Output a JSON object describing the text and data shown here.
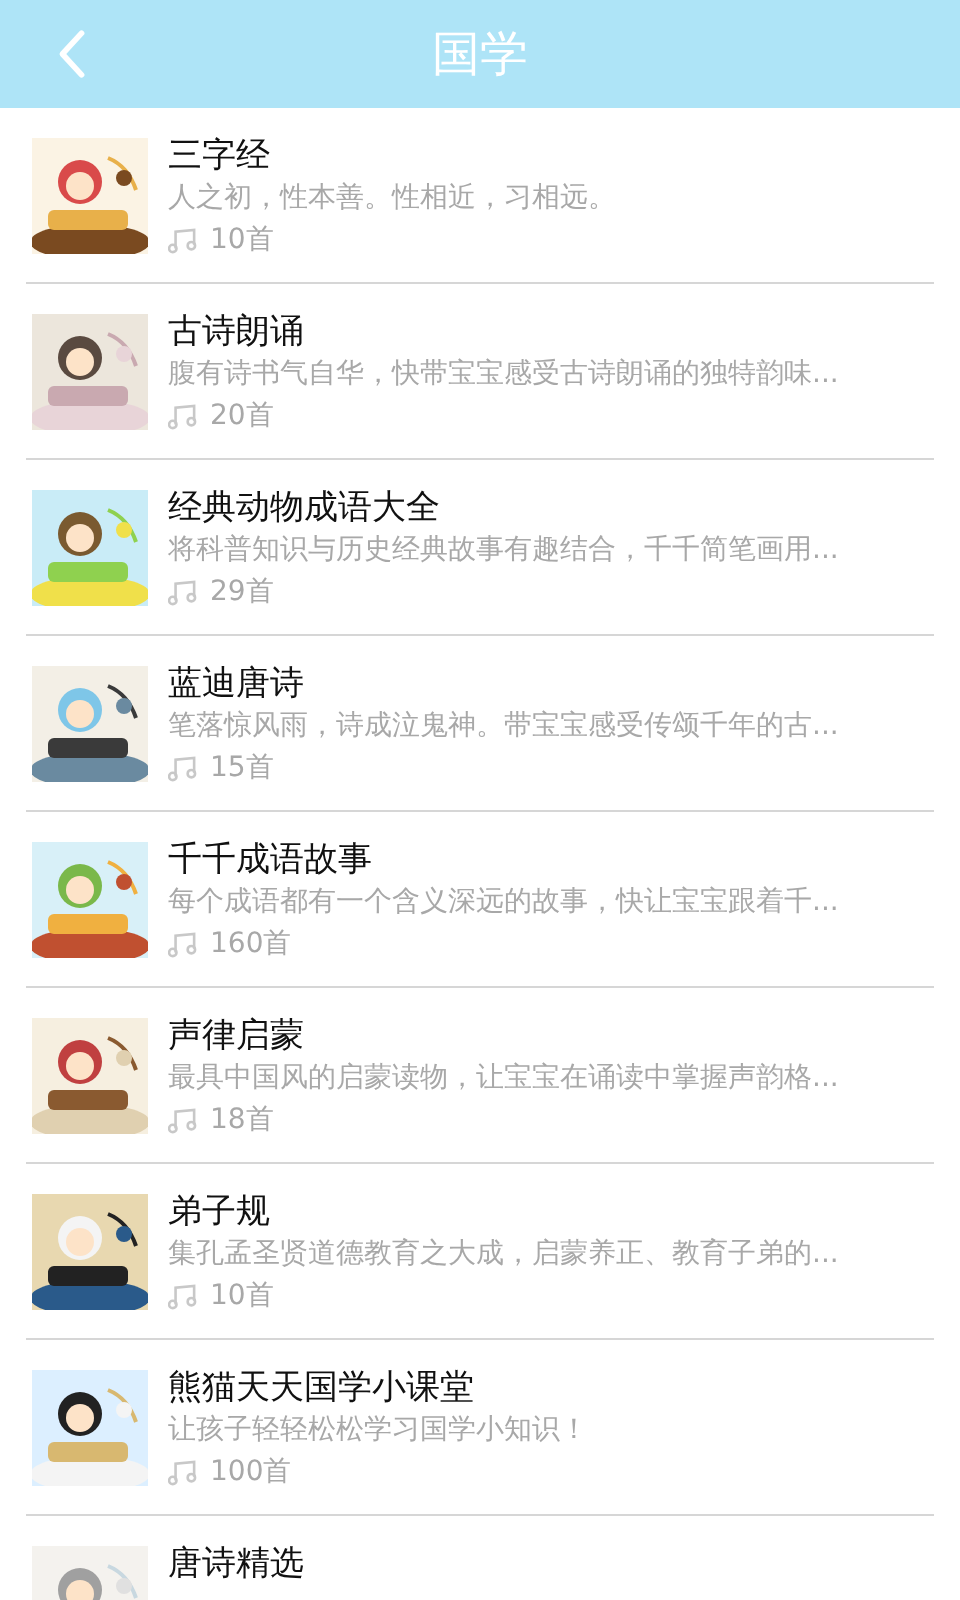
{
  "header": {
    "title": "国学"
  },
  "items": [
    {
      "title": "三字经",
      "description": "人之初，性本善。性相近，习相远。",
      "count": "10首"
    },
    {
      "title": "古诗朗诵",
      "description": "腹有诗书气自华，快带宝宝感受古诗朗诵的独特韵味...",
      "count": "20首"
    },
    {
      "title": "经典动物成语大全",
      "description": "将科普知识与历史经典故事有趣结合，千千简笔画用...",
      "count": "29首"
    },
    {
      "title": "蓝迪唐诗",
      "description": "笔落惊风雨，诗成泣鬼神。带宝宝感受传颂千年的古...",
      "count": "15首"
    },
    {
      "title": "千千成语故事",
      "description": "每个成语都有一个含义深远的故事，快让宝宝跟着千...",
      "count": "160首"
    },
    {
      "title": "声律启蒙",
      "description": "最具中国风的启蒙读物，让宝宝在诵读中掌握声韵格...",
      "count": "18首"
    },
    {
      "title": "弟子规",
      "description": "集孔孟圣贤道德教育之大成，启蒙养正、教育子弟的...",
      "count": "10首"
    },
    {
      "title": "熊猫天天国学小课堂",
      "description": "让孩子轻轻松松学习国学小知识！",
      "count": "100首"
    },
    {
      "title": "唐诗精选"
    }
  ]
}
